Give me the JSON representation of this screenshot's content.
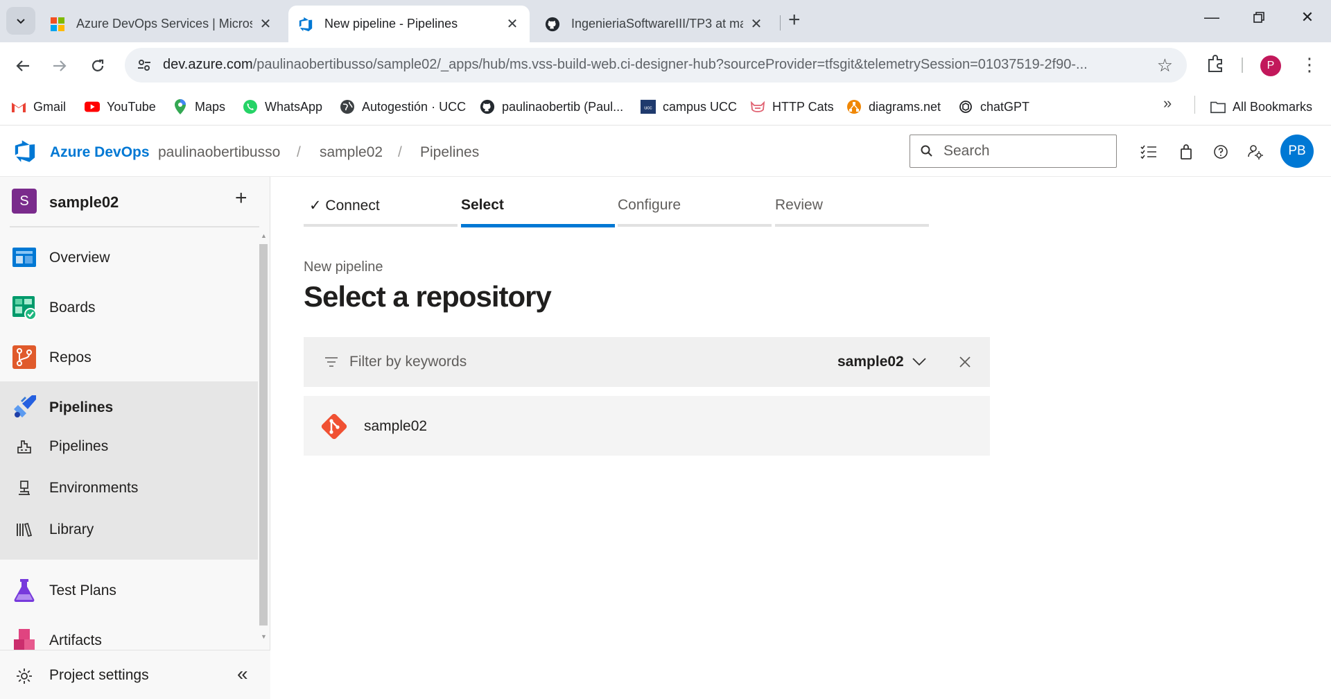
{
  "browser": {
    "tabs": [
      {
        "title": "Azure DevOps Services | Micros"
      },
      {
        "title": "New pipeline - Pipelines"
      },
      {
        "title": "IngenieriaSoftwareIII/TP3 at ma"
      }
    ],
    "url_host": "dev.azure.com",
    "url_path": "/paulinaobertibusso/sample02/_apps/hub/ms.vss-build-web.ci-designer-hub?sourceProvider=tfsgit&telemetrySession=01037519-2f90-...",
    "profile_initial": "P",
    "bookmarks": [
      {
        "label": "Gmail"
      },
      {
        "label": "YouTube"
      },
      {
        "label": "Maps"
      },
      {
        "label": "WhatsApp"
      },
      {
        "label": "Autogestión · UCC"
      },
      {
        "label": "paulinaobertib (Paul..."
      },
      {
        "label": "campus UCC"
      },
      {
        "label": "HTTP Cats"
      },
      {
        "label": "diagrams.net"
      },
      {
        "label": "chatGPT"
      }
    ],
    "all_bookmarks": "All Bookmarks",
    "more_bookmarks": "»"
  },
  "header": {
    "brand": "Azure DevOps",
    "breadcrumb": [
      "paulinaobertibusso",
      "sample02",
      "Pipelines"
    ],
    "separator": "/",
    "search_placeholder": "Search",
    "avatar_initials": "PB"
  },
  "sidebar": {
    "project_initial": "S",
    "project_name": "sample02",
    "add": "+",
    "items": [
      {
        "label": "Overview"
      },
      {
        "label": "Boards"
      },
      {
        "label": "Repos"
      },
      {
        "label": "Pipelines"
      },
      {
        "label": "Test Plans"
      },
      {
        "label": "Artifacts"
      }
    ],
    "pipelines_sub": [
      {
        "label": "Pipelines"
      },
      {
        "label": "Environments"
      },
      {
        "label": "Library"
      }
    ],
    "project_settings": "Project settings",
    "collapse": "«"
  },
  "wizard": {
    "steps": [
      {
        "label": "✓ Connect",
        "state": "done"
      },
      {
        "label": "Select",
        "state": "current"
      },
      {
        "label": "Configure",
        "state": "pending"
      },
      {
        "label": "Review",
        "state": "pending"
      }
    ]
  },
  "main": {
    "subtitle": "New pipeline",
    "title": "Select a repository",
    "filter_placeholder": "Filter by keywords",
    "scope": "sample02",
    "repos": [
      {
        "name": "sample02"
      }
    ]
  },
  "colors": {
    "accent": "#0078d4",
    "git_orange": "#f05133",
    "project_badge": "#7a2b8c"
  }
}
